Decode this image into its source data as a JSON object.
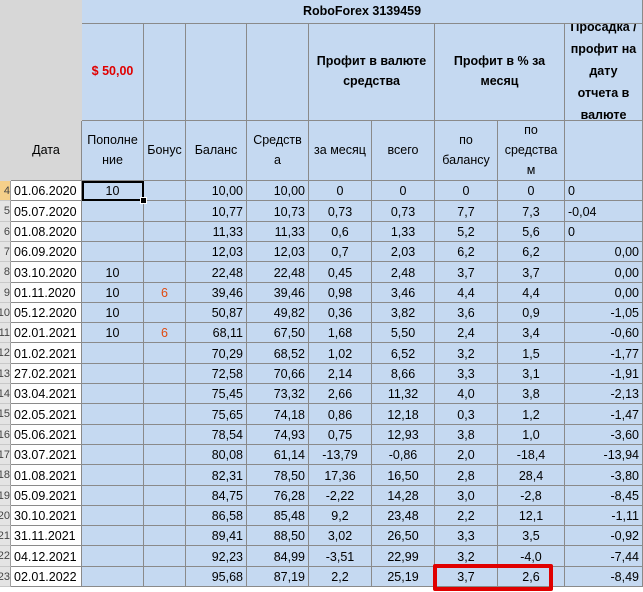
{
  "sheet_title": "RoboForex 3139459",
  "deposit_label": "$   50,00",
  "headers": {
    "date": "Дата",
    "deposit": "Пополне ние",
    "bonus": "Бонус",
    "balance": "Баланс",
    "equity": "Средств а",
    "profit_currency_group": "Профит в валюте средства",
    "profit_percent_group": "Профит в % за месяц",
    "drawdown": "Просадка /профит на дату отчета в валюте",
    "profit_month": "за месяц",
    "profit_total": "всего",
    "pct_balance": "по балансу",
    "pct_equity": "по средства м"
  },
  "row_numbers": [
    "4",
    "5",
    "6",
    "7",
    "8",
    "9",
    "10",
    "11",
    "12",
    "13",
    "14",
    "15",
    "16",
    "17",
    "18",
    "19",
    "20",
    "21",
    "22",
    "23"
  ],
  "rows": [
    {
      "date": "01.06.2020",
      "deposit": "10",
      "bonus": "",
      "balance": "10,00",
      "equity": "10,00",
      "pm": "0",
      "pt": "0",
      "pb": "0",
      "pe": "0",
      "dd": "0",
      "dd_align": "l"
    },
    {
      "date": "05.07.2020",
      "deposit": "",
      "bonus": "",
      "balance": "10,77",
      "equity": "10,73",
      "pm": "0,73",
      "pt": "0,73",
      "pb": "7,7",
      "pe": "7,3",
      "dd": "-0,04",
      "dd_align": "l"
    },
    {
      "date": "01.08.2020",
      "deposit": "",
      "bonus": "",
      "balance": "11,33",
      "equity": "11,33",
      "pm": "0,6",
      "pt": "1,33",
      "pb": "5,2",
      "pe": "5,6",
      "dd": "0",
      "dd_align": "l"
    },
    {
      "date": "06.09.2020",
      "deposit": "",
      "bonus": "",
      "balance": "12,03",
      "equity": "12,03",
      "pm": "0,7",
      "pt": "2,03",
      "pb": "6,2",
      "pe": "6,2",
      "dd": "0,00",
      "dd_align": "r"
    },
    {
      "date": "03.10.2020",
      "deposit": "10",
      "bonus": "",
      "balance": "22,48",
      "equity": "22,48",
      "pm": "0,45",
      "pt": "2,48",
      "pb": "3,7",
      "pe": "3,7",
      "dd": "0,00",
      "dd_align": "r"
    },
    {
      "date": "01.11.2020",
      "deposit": "10",
      "bonus": "6",
      "balance": "39,46",
      "equity": "39,46",
      "pm": "0,98",
      "pt": "3,46",
      "pb": "4,4",
      "pe": "4,4",
      "dd": "0,00",
      "dd_align": "r"
    },
    {
      "date": "05.12.2020",
      "deposit": "10",
      "bonus": "",
      "balance": "50,87",
      "equity": "49,82",
      "pm": "0,36",
      "pt": "3,82",
      "pb": "3,6",
      "pe": "0,9",
      "dd": "-1,05",
      "dd_align": "r"
    },
    {
      "date": "02.01.2021",
      "deposit": "10",
      "bonus": "6",
      "balance": "68,11",
      "equity": "67,50",
      "pm": "1,68",
      "pt": "5,50",
      "pb": "2,4",
      "pe": "3,4",
      "dd": "-0,60",
      "dd_align": "r"
    },
    {
      "date": "01.02.2021",
      "deposit": "",
      "bonus": "",
      "balance": "70,29",
      "equity": "68,52",
      "pm": "1,02",
      "pt": "6,52",
      "pb": "3,2",
      "pe": "1,5",
      "dd": "-1,77",
      "dd_align": "r"
    },
    {
      "date": "27.02.2021",
      "deposit": "",
      "bonus": "",
      "balance": "72,58",
      "equity": "70,66",
      "pm": "2,14",
      "pt": "8,66",
      "pb": "3,3",
      "pe": "3,1",
      "dd": "-1,91",
      "dd_align": "r"
    },
    {
      "date": "03.04.2021",
      "deposit": "",
      "bonus": "",
      "balance": "75,45",
      "equity": "73,32",
      "pm": "2,66",
      "pt": "11,32",
      "pb": "4,0",
      "pe": "3,8",
      "dd": "-2,13",
      "dd_align": "r"
    },
    {
      "date": "02.05.2021",
      "deposit": "",
      "bonus": "",
      "balance": "75,65",
      "equity": "74,18",
      "pm": "0,86",
      "pt": "12,18",
      "pb": "0,3",
      "pe": "1,2",
      "dd": "-1,47",
      "dd_align": "r"
    },
    {
      "date": "05.06.2021",
      "deposit": "",
      "bonus": "",
      "balance": "78,54",
      "equity": "74,93",
      "pm": "0,75",
      "pt": "12,93",
      "pb": "3,8",
      "pe": "1,0",
      "dd": "-3,60",
      "dd_align": "r"
    },
    {
      "date": "03.07.2021",
      "deposit": "",
      "bonus": "",
      "balance": "80,08",
      "equity": "61,14",
      "pm": "-13,79",
      "pt": "-0,86",
      "pb": "2,0",
      "pe": "-18,4",
      "dd": "-13,94",
      "dd_align": "r"
    },
    {
      "date": "01.08.2021",
      "deposit": "",
      "bonus": "",
      "balance": "82,31",
      "equity": "78,50",
      "pm": "17,36",
      "pt": "16,50",
      "pb": "2,8",
      "pe": "28,4",
      "dd": "-3,80",
      "dd_align": "r"
    },
    {
      "date": "05.09.2021",
      "deposit": "",
      "bonus": "",
      "balance": "84,75",
      "equity": "76,28",
      "pm": "-2,22",
      "pt": "14,28",
      "pb": "3,0",
      "pe": "-2,8",
      "dd": "-8,45",
      "dd_align": "r"
    },
    {
      "date": "30.10.2021",
      "deposit": "",
      "bonus": "",
      "balance": "86,58",
      "equity": "85,48",
      "pm": "9,2",
      "pt": "23,48",
      "pb": "2,2",
      "pe": "12,1",
      "dd": "-1,11",
      "dd_align": "r"
    },
    {
      "date": "31.11.2021",
      "deposit": "",
      "bonus": "",
      "balance": "89,41",
      "equity": "88,50",
      "pm": "3,02",
      "pt": "26,50",
      "pb": "3,3",
      "pe": "3,5",
      "dd": "-0,92",
      "dd_align": "r"
    },
    {
      "date": "04.12.2021",
      "deposit": "",
      "bonus": "",
      "balance": "92,23",
      "equity": "84,99",
      "pm": "-3,51",
      "pt": "22,99",
      "pb": "3,2",
      "pe": "-4,0",
      "dd": "-7,44",
      "dd_align": "r"
    },
    {
      "date": "02.01.2022",
      "deposit": "",
      "bonus": "",
      "balance": "95,68",
      "equity": "87,19",
      "pm": "2,2",
      "pt": "25,19",
      "pb": "3,7",
      "pe": "2,6",
      "dd": "-8,49",
      "dd_align": "r"
    }
  ],
  "colors": {
    "cell_bg": "#c5d9f1",
    "grid": "#8a8a8a",
    "highlight": "#e00000",
    "bonus": "#e04a10"
  }
}
